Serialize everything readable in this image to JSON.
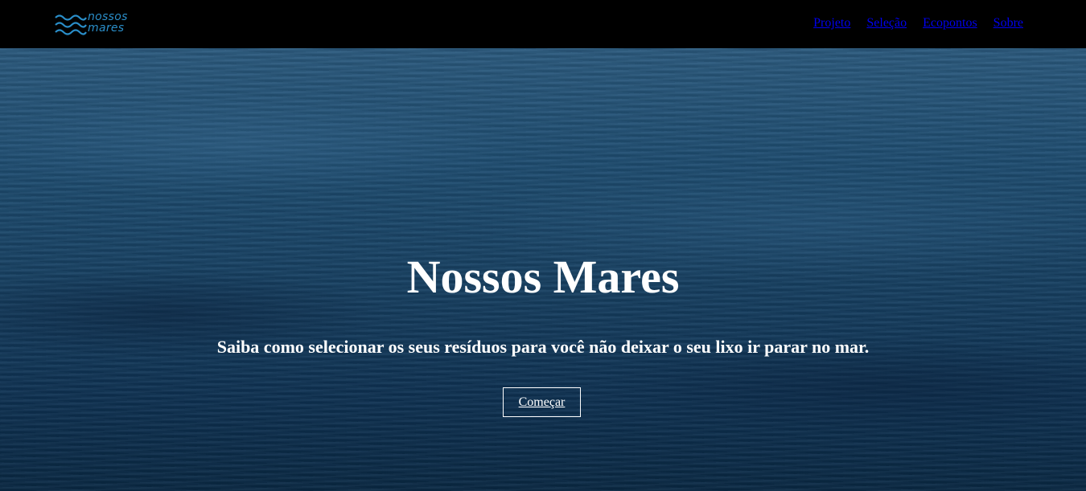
{
  "brand": {
    "logo_line1": "nossos",
    "logo_line2": "mares",
    "logo_icon": "waves-icon",
    "accent_color": "#2a8ec9"
  },
  "nav": {
    "items": [
      {
        "label": "Projeto"
      },
      {
        "label": "Seleção"
      },
      {
        "label": "Ecopontos"
      },
      {
        "label": "Sobre"
      }
    ],
    "link_color": "#0000ee"
  },
  "hero": {
    "title": "Nossos Mares",
    "subtitle": "Saiba como selecionar os seus resíduos para você não deixar o seu lixo ir parar no mar.",
    "cta_label": "Começar",
    "background": "ocean-water-image"
  }
}
